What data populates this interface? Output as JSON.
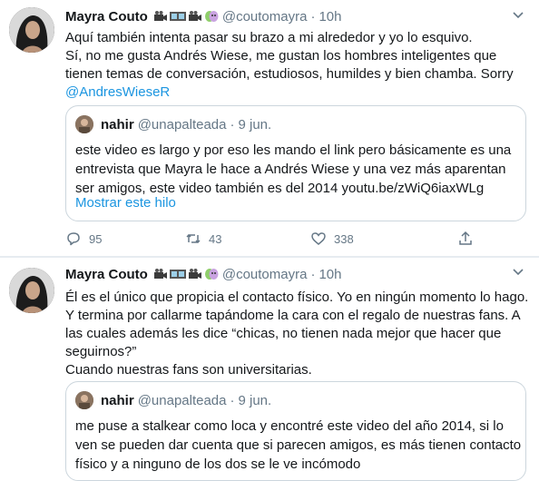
{
  "tweets": [
    {
      "author_name": "Mayra Couto",
      "handle": "@coutomayra",
      "dot": "·",
      "time": "10h",
      "body_lines": [
        "Aquí también intenta pasar su brazo a mi alrededor y yo lo esquivo.",
        "Sí, no me gusta Andrés Wiese, me gustan los hombres inteligentes que",
        "tienen temas de conversación, estudiosos, humildes y bien chamba. Sorry"
      ],
      "mention": "@AndresWieseR",
      "quote": {
        "name": "nahir",
        "handle": "@unapalteada",
        "dot": "·",
        "time": "9 jun.",
        "body_lines": [
          "este video es largo y por eso les mando el link pero básicamente es una",
          "entrevista que Mayra le hace a Andrés Wiese y una vez más aparentan",
          "ser amigos, este video también es del 2014 youtu.be/zWiQ6iaxWLg"
        ],
        "show_thread": "Mostrar este hilo"
      },
      "actions": {
        "replies": "95",
        "retweets": "43",
        "likes": "338"
      }
    },
    {
      "author_name": "Mayra Couto",
      "handle": "@coutomayra",
      "dot": "·",
      "time": "10h",
      "body_lines": [
        "Él es el único que propicia el contacto físico. Yo en ningún momento lo hago.",
        "Y termina por callarme tapándome la cara con el regalo de nuestras fans. A",
        "las cuales además les dice “chicas, no tienen nada mejor que hacer que",
        "seguirnos?”",
        "Cuando nuestras fans son universitarias."
      ],
      "quote": {
        "name": "nahir",
        "handle": "@unapalteada",
        "dot": "·",
        "time": "9 jun.",
        "body_lines": [
          "me puse a stalkear como loca y encontré este video del año 2014, si lo",
          "ven se pueden dar cuenta que si parecen amigos, es más tienen contacto",
          "físico y a ninguno de los dos se le ve incómodo"
        ]
      }
    }
  ],
  "icons": {
    "emojis": [
      "movie-camera-icon",
      "film-frames-icon",
      "movie-camera-icon",
      "performing-arts-icon"
    ],
    "chevron": "chevron-down-icon",
    "reply": "reply-icon",
    "retweet": "retweet-icon",
    "like": "heart-icon",
    "share": "share-icon"
  },
  "colors": {
    "link": "#1b95e0",
    "secondary_text": "#657786",
    "border": "#ccd6dd"
  }
}
